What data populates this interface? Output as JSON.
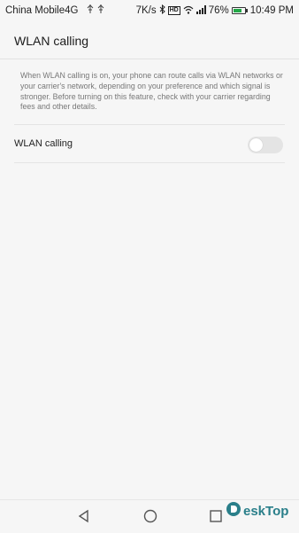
{
  "status_bar": {
    "carrier": "China Mobile4G",
    "net_speed": "7K/s",
    "hd": "HD",
    "battery": "76%",
    "battery_level": 0.76,
    "time": "10:49 PM"
  },
  "header": {
    "title": "WLAN calling"
  },
  "main": {
    "description": "When WLAN calling is on, your phone can route calls via WLAN networks or your carrier's network, depending on your preference and which signal is stronger. Before turning on this feature, check with your carrier regarding fees and other details.",
    "setting": {
      "label": "WLAN calling",
      "enabled": false
    }
  },
  "nav": {
    "back_icon": "back-triangle-icon",
    "home_icon": "home-circle-icon",
    "recents_icon": "recents-square-icon"
  },
  "watermark": {
    "text": "eskTop",
    "icon": "desktop-logo-icon"
  },
  "colors": {
    "toggle_off": "#e4e4e4",
    "battery": "#23a847",
    "watermark": "#2a7f8a"
  }
}
